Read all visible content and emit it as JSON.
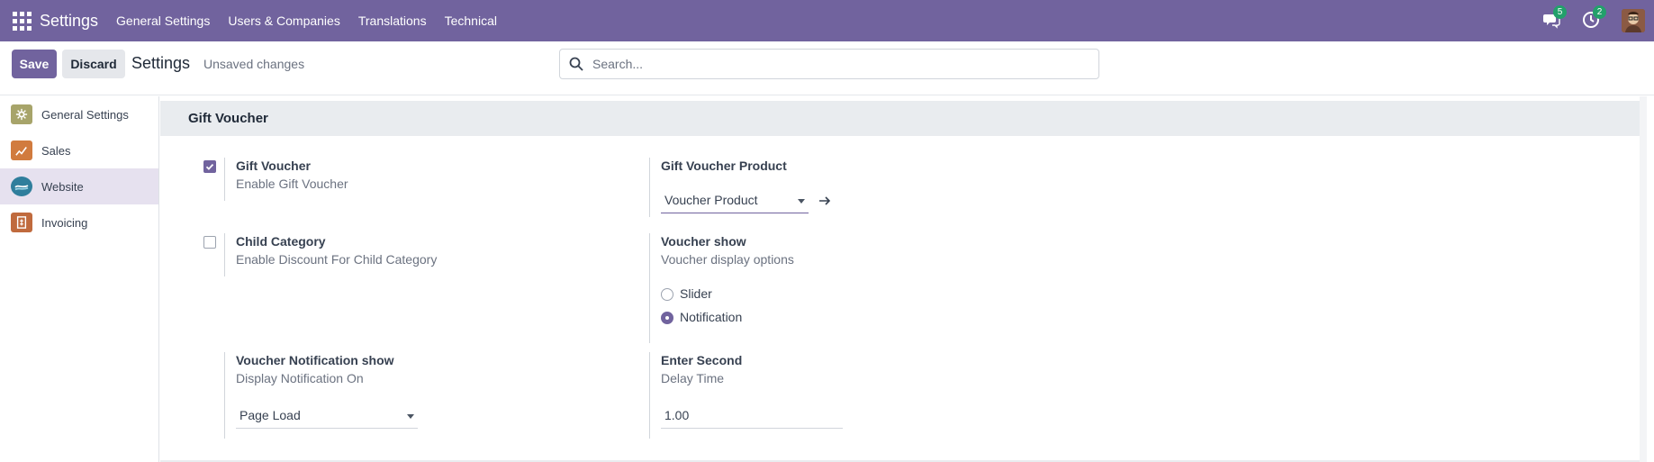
{
  "topbar": {
    "brand": "Settings",
    "nav": [
      "General Settings",
      "Users & Companies",
      "Translations",
      "Technical"
    ],
    "messages_badge": "5",
    "activity_badge": "2"
  },
  "controls": {
    "save_label": "Save",
    "discard_label": "Discard",
    "title": "Settings",
    "status": "Unsaved changes",
    "search_placeholder": "Search..."
  },
  "sidebar": {
    "items": [
      {
        "label": "General Settings",
        "active": false
      },
      {
        "label": "Sales",
        "active": false
      },
      {
        "label": "Website",
        "active": true
      },
      {
        "label": "Invoicing",
        "active": false
      }
    ]
  },
  "section": {
    "title": "Gift Voucher",
    "gift_voucher": {
      "label": "Gift Voucher",
      "description": "Enable Gift Voucher",
      "checked": true
    },
    "gift_voucher_product": {
      "label": "Gift Voucher Product",
      "value": "Voucher Product"
    },
    "child_category": {
      "label": "Child Category",
      "description": "Enable Discount For Child Category",
      "checked": false
    },
    "voucher_show": {
      "label": "Voucher show",
      "description": "Voucher display options",
      "options": [
        {
          "label": "Slider",
          "checked": false
        },
        {
          "label": "Notification",
          "checked": true
        }
      ]
    },
    "voucher_notification_show": {
      "label": "Voucher Notification show",
      "description": "Display Notification On",
      "value": "Page Load"
    },
    "enter_second": {
      "label": "Enter Second",
      "description": "Delay Time",
      "value": "1.00"
    }
  },
  "colors": {
    "brand": "#71639e",
    "badge": "#22a06b"
  }
}
